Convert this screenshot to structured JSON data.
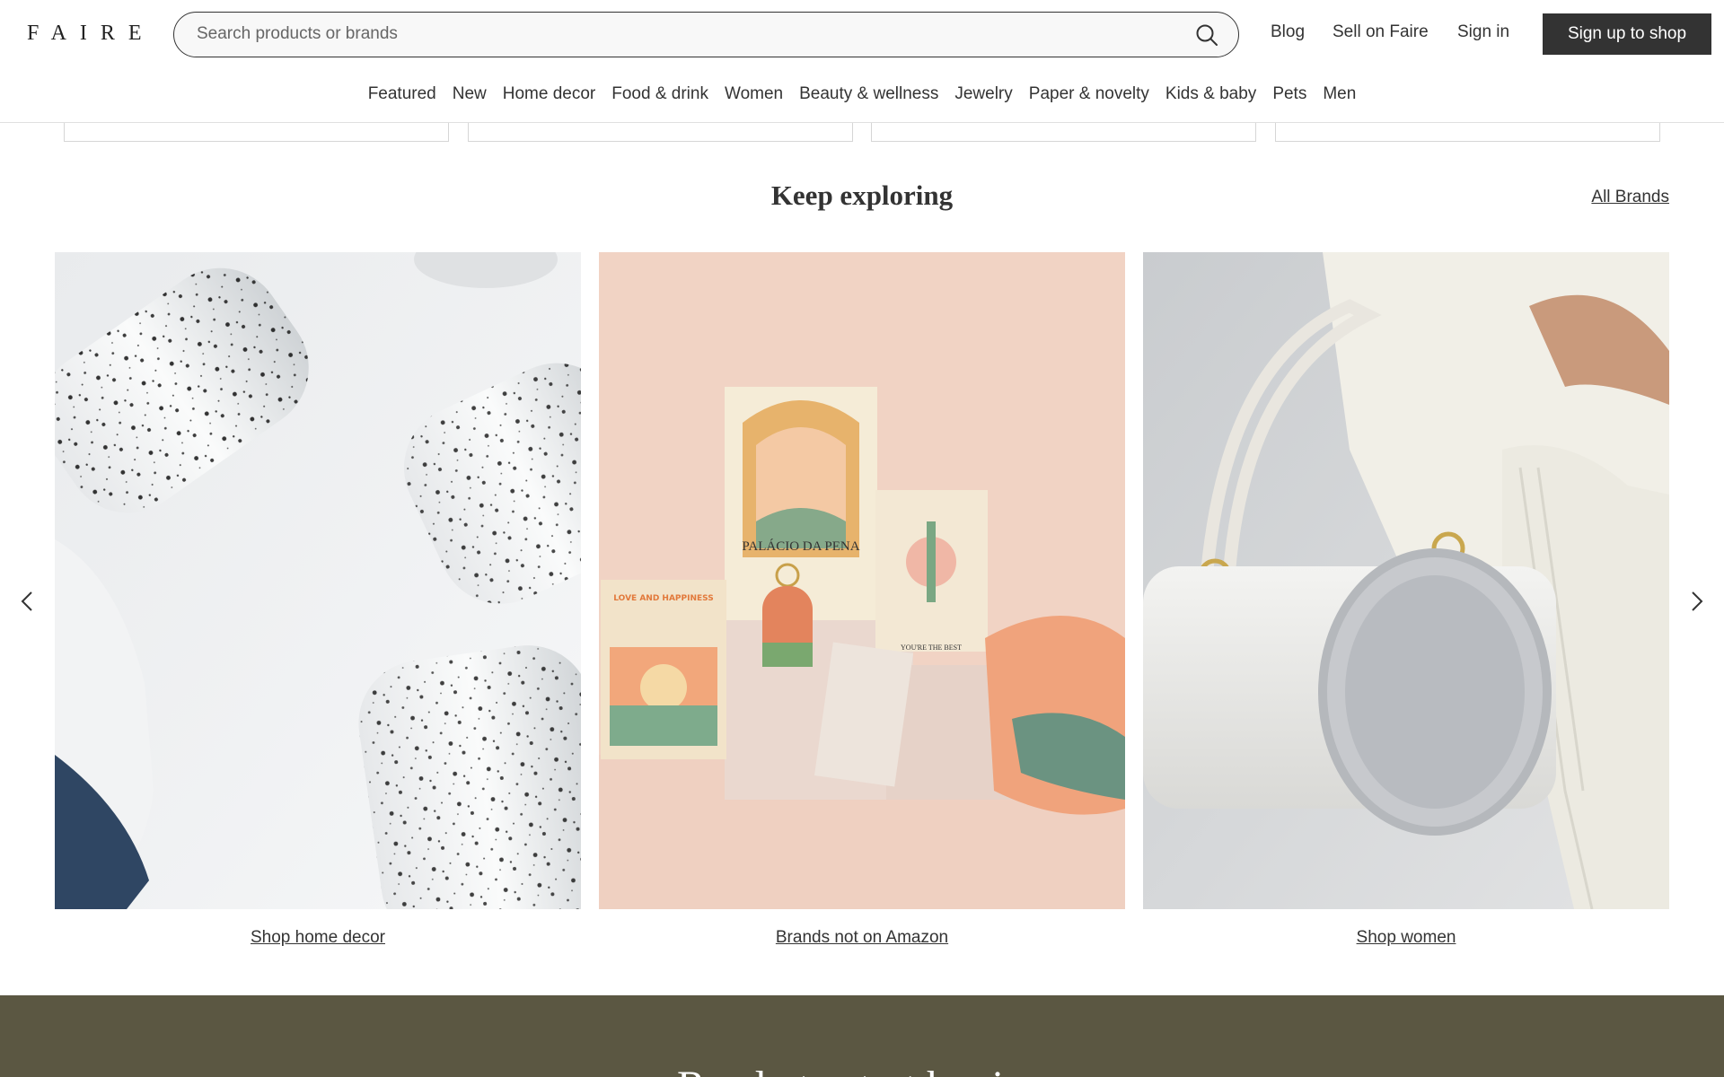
{
  "header": {
    "logo": "FAIRE",
    "search_placeholder": "Search products or brands",
    "links": {
      "blog": "Blog",
      "sell": "Sell on Faire",
      "signin": "Sign in"
    },
    "signup_label": "Sign up to shop"
  },
  "categories": [
    "Featured",
    "New",
    "Home decor",
    "Food & drink",
    "Women",
    "Beauty & wellness",
    "Jewelry",
    "Paper & novelty",
    "Kids & baby",
    "Pets",
    "Men"
  ],
  "section": {
    "title": "Keep exploring",
    "all_brands": "All Brands"
  },
  "tiles": [
    {
      "caption": "Shop home decor",
      "image": "speckled-ceramic-tumblers"
    },
    {
      "caption": "Brands not on Amazon",
      "image": "greeting-cards-and-keychain"
    },
    {
      "caption": "Shop women",
      "image": "grey-barrel-handbag"
    }
  ],
  "tile_image_text": {
    "card1": "PALÁCIO DA PENA",
    "card2": "LOVE AND HAPPINESS",
    "card3": "YOU'RE THE BEST"
  },
  "footer": {
    "title": "Ready to start buying"
  },
  "colors": {
    "dark_button": "#333333",
    "footer_band": "#5b5742",
    "tile_pink": "#f1d3c4"
  }
}
